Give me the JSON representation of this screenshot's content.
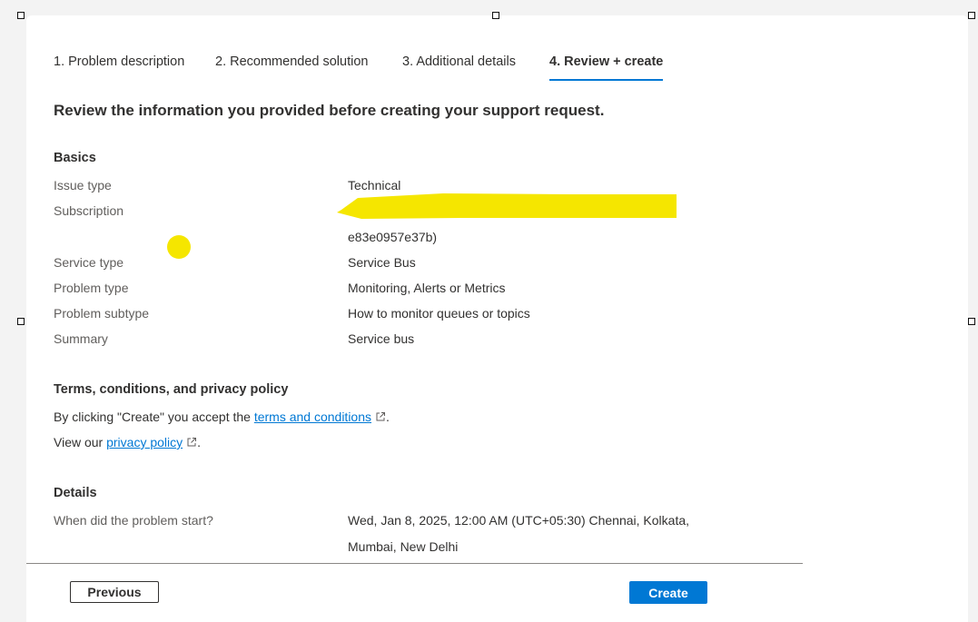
{
  "tabs": [
    {
      "label": "1. Problem description"
    },
    {
      "label": "2. Recommended solution"
    },
    {
      "label": "3. Additional details"
    },
    {
      "label": "4. Review + create"
    }
  ],
  "heading": "Review the information you provided before creating your support request.",
  "basics": {
    "title": "Basics",
    "rows": [
      {
        "label": "Issue type",
        "value": "Technical"
      },
      {
        "label": "Subscription",
        "value": "",
        "value_line2": "e83e0957e37b)"
      },
      {
        "label": "Service type",
        "value": "Service Bus"
      },
      {
        "label": "Problem type",
        "value": "Monitoring, Alerts or Metrics"
      },
      {
        "label": "Problem subtype",
        "value": "How to monitor queues or topics"
      },
      {
        "label": "Summary",
        "value": "Service bus"
      }
    ]
  },
  "terms": {
    "title": "Terms, conditions, and privacy policy",
    "line1_prefix": "By clicking \"Create\" you accept the ",
    "line1_link": "terms and conditions",
    "line1_suffix": ".",
    "line2_prefix": "View our ",
    "line2_link": "privacy policy",
    "line2_suffix": "."
  },
  "details": {
    "title": "Details",
    "rows": [
      {
        "label": "When did the problem start?",
        "value": "Wed, Jan 8, 2025, 12:00 AM (UTC+05:30) Chennai, Kolkata,",
        "value_line2": "Mumbai, New Delhi"
      }
    ]
  },
  "footer": {
    "previous_label": "Previous",
    "create_label": "Create"
  },
  "colors": {
    "accent": "#0078d4",
    "highlight": "#f5e600"
  }
}
